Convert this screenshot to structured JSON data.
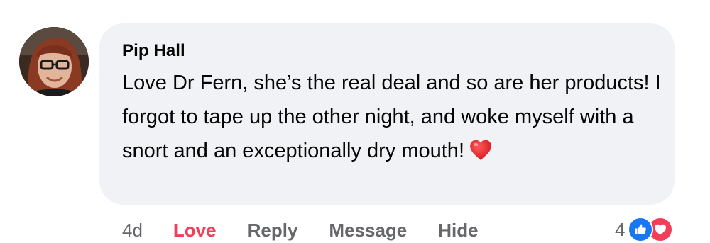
{
  "comment": {
    "author": "Pip Hall",
    "text": "Love Dr Fern, she’s the real deal and so are her products! I forgot to tape up the other night, and woke myself with a  snort and an exceptionally dry mouth!",
    "emoji": "heart-emoji"
  },
  "actions": {
    "timestamp": "4d",
    "love_label": "Love",
    "reply_label": "Reply",
    "message_label": "Message",
    "hide_label": "Hide"
  },
  "reactions": {
    "count": "4",
    "types": [
      "like-icon",
      "love-icon"
    ]
  },
  "colors": {
    "bubble": "#f0f2f5",
    "love_active": "#f33e58",
    "like_blue": "#1877f2",
    "secondary_text": "#65676b"
  }
}
